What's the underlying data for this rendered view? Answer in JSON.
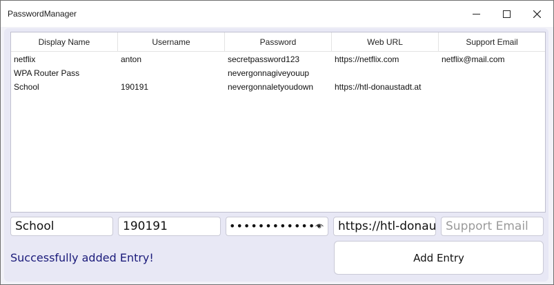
{
  "window": {
    "title": "PasswordManager"
  },
  "table": {
    "columns": [
      "Display Name",
      "Username",
      "Password",
      "Web URL",
      "Support Email"
    ],
    "rows": [
      [
        "netflix",
        "anton",
        "secretpassword123",
        "https://netflix.com",
        "netflix@mail.com"
      ],
      [
        "WPA Router Pass",
        "",
        "nevergonnagiveyouup",
        "",
        ""
      ],
      [
        "School",
        "190191",
        "nevergonnaletyoudown",
        "https://htl-donaustadt.at",
        ""
      ]
    ]
  },
  "form": {
    "display_name_value": "School",
    "username_value": "190191",
    "password_masked": "•••••••••••••",
    "url_value": "https://htl-donaust",
    "email_placeholder": "Support Email",
    "add_button": "Add Entry"
  },
  "status": {
    "message": "Successfully added Entry!"
  }
}
